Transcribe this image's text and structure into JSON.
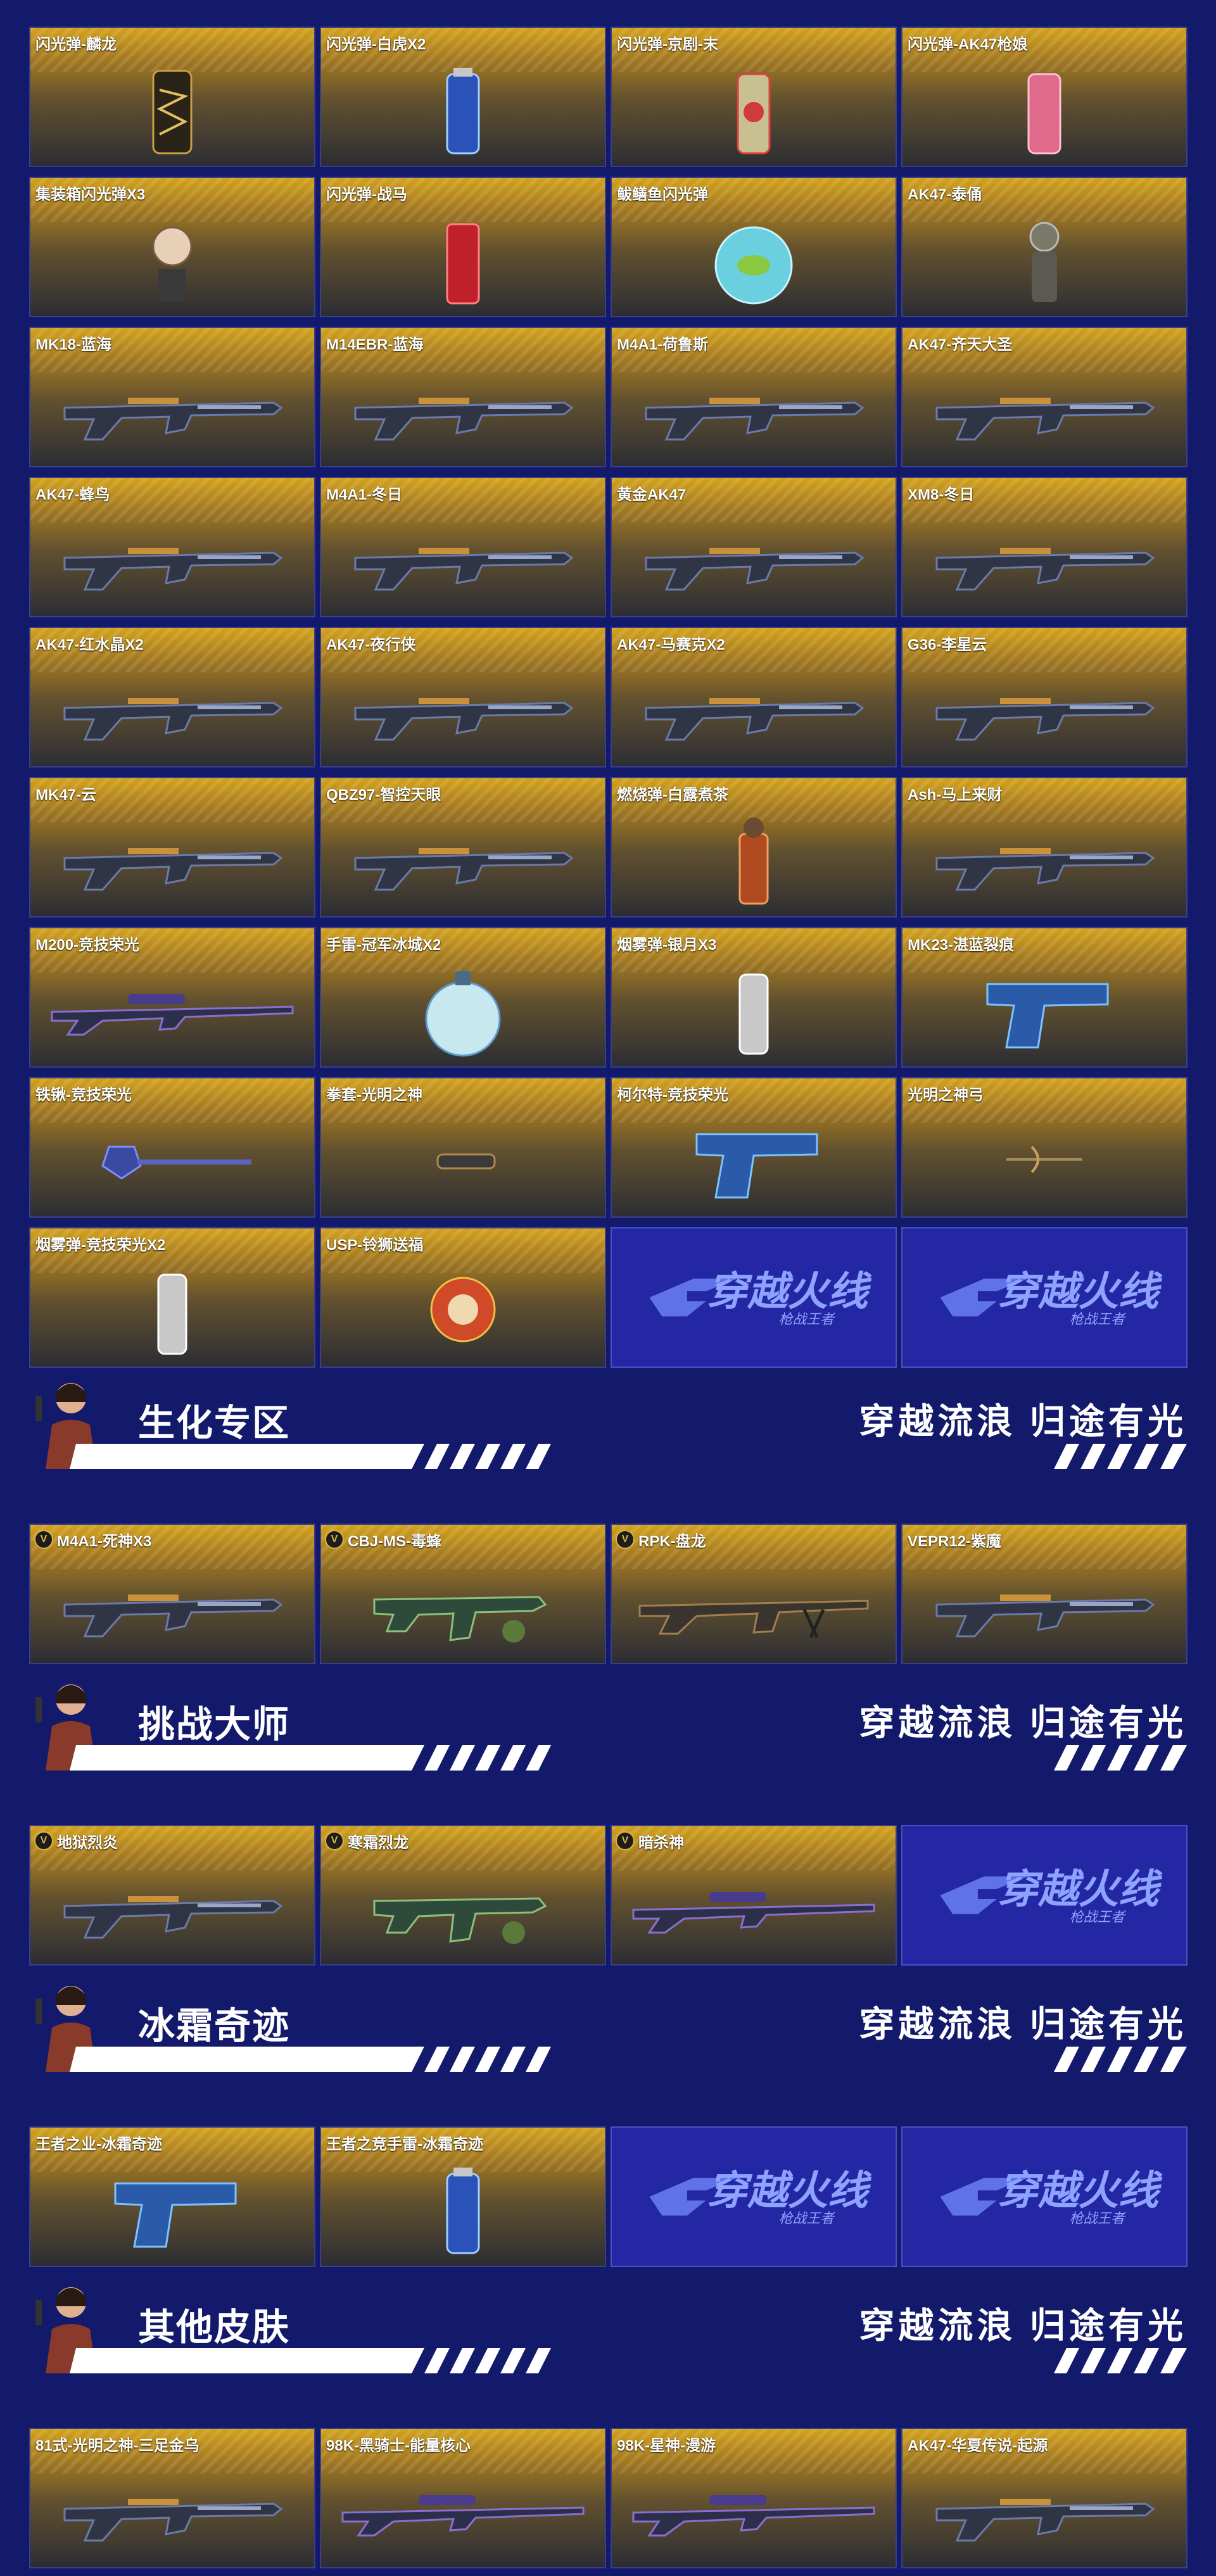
{
  "slogan": "穿越流浪 归途有光",
  "logo": {
    "main": "穿越火线",
    "sub": "枪战王者"
  },
  "v_badge": "V",
  "grid1": [
    {
      "name": "闪光弹-麟龙",
      "icon": "grenade-dragon-icon"
    },
    {
      "name": "闪光弹-白虎X2",
      "icon": "grenade-can-icon"
    },
    {
      "name": "闪光弹-京剧-末",
      "icon": "grenade-opera-icon"
    },
    {
      "name": "闪光弹-AK47枪娘",
      "icon": "grenade-pink-icon"
    },
    {
      "name": "集装箱闪光弹X3",
      "icon": "container-doll-icon"
    },
    {
      "name": "闪光弹-战马",
      "icon": "red-can-icon"
    },
    {
      "name": "鲅鳝鱼闪光弹",
      "icon": "fishbowl-icon"
    },
    {
      "name": "AK47-泰俑",
      "icon": "figure-icon"
    },
    {
      "name": "MK18-蓝海",
      "icon": "rifle-icon"
    },
    {
      "name": "M14EBR-蓝海",
      "icon": "rifle-icon"
    },
    {
      "name": "M4A1-荷鲁斯",
      "icon": "rifle-icon"
    },
    {
      "name": "AK47-齐天大圣",
      "icon": "rifle-icon"
    },
    {
      "name": "AK47-蜂鸟",
      "icon": "rifle-icon"
    },
    {
      "name": "M4A1-冬日",
      "icon": "rifle-icon"
    },
    {
      "name": "黄金AK47",
      "icon": "rifle-icon"
    },
    {
      "name": "XM8-冬日",
      "icon": "rifle-icon"
    },
    {
      "name": "AK47-红水晶X2",
      "icon": "rifle-icon"
    },
    {
      "name": "AK47-夜行侠",
      "icon": "rifle-icon"
    },
    {
      "name": "AK47-马赛克X2",
      "icon": "rifle-icon"
    },
    {
      "name": "G36-李星云",
      "icon": "rifle-icon"
    },
    {
      "name": "MK47-云",
      "icon": "rifle-icon"
    },
    {
      "name": "QBZ97-智控天眼",
      "icon": "rifle-icon"
    },
    {
      "name": "燃烧弹-白露煮茶",
      "icon": "teapot-grenade-icon"
    },
    {
      "name": "Ash-马上来财",
      "icon": "rifle-icon"
    },
    {
      "name": "M200-竞技荣光",
      "icon": "sniper-icon"
    },
    {
      "name": "手雷-冠军冰城X2",
      "icon": "grenade-round-icon"
    },
    {
      "name": "烟雾弹-银月X3",
      "icon": "smoke-canister-icon"
    },
    {
      "name": "MK23-湛蓝裂痕",
      "icon": "pistol-icon"
    },
    {
      "name": "铁锹-竞技荣光",
      "icon": "shovel-icon"
    },
    {
      "name": "拳套-光明之神",
      "icon": "knuckle-icon"
    },
    {
      "name": "柯尔特-竞技荣光",
      "icon": "pistol-icon"
    },
    {
      "name": "光明之神弓",
      "icon": "bow-icon"
    },
    {
      "name": "烟雾弹-竞技荣光X2",
      "icon": "smoke-canister-icon"
    },
    {
      "name": "USP-铃狮送福",
      "icon": "lion-figure-icon"
    },
    {
      "logo": true
    },
    {
      "logo": true
    }
  ],
  "sections": [
    {
      "title": "生化专区",
      "items": [
        {
          "name": "M4A1-死神X3",
          "v": true,
          "icon": "rifle-icon"
        },
        {
          "name": "CBJ-MS-毒蜂",
          "v": true,
          "icon": "smg-icon"
        },
        {
          "name": "RPK-盘龙",
          "v": true,
          "icon": "machine-gun-icon"
        },
        {
          "name": "VEPR12-紫魔",
          "v": false,
          "icon": "rifle-icon"
        }
      ]
    },
    {
      "title": "挑战大师",
      "items": [
        {
          "name": "地狱烈炎",
          "v": true,
          "icon": "rifle-icon"
        },
        {
          "name": "寒霜烈龙",
          "v": true,
          "icon": "smg-icon"
        },
        {
          "name": "暗杀神",
          "v": true,
          "icon": "sniper-icon"
        },
        {
          "logo": true
        }
      ]
    },
    {
      "title": "冰霜奇迹",
      "items": [
        {
          "name": "王者之业-冰霜奇迹",
          "v": false,
          "icon": "pistol-icon"
        },
        {
          "name": "王者之竞手雷-冰霜奇迹",
          "v": false,
          "icon": "grenade-can-icon"
        },
        {
          "logo": true
        },
        {
          "logo": true
        }
      ]
    },
    {
      "title": "其他皮肤",
      "items": [
        {
          "name": "81式-光明之神-三足金乌",
          "v": false,
          "icon": "rifle-icon"
        },
        {
          "name": "98K-黑骑士-能量核心",
          "v": false,
          "icon": "sniper-icon"
        },
        {
          "name": "98K-星神-漫游",
          "v": false,
          "icon": "sniper-icon"
        },
        {
          "name": "AK47-华夏传说-起源",
          "v": false,
          "icon": "rifle-icon"
        }
      ]
    }
  ],
  "colors": {
    "background": "#13196b",
    "card_gold": "#d3a21c",
    "logo_blue": "#2327a3",
    "badge_gold": "#e0b43a"
  }
}
